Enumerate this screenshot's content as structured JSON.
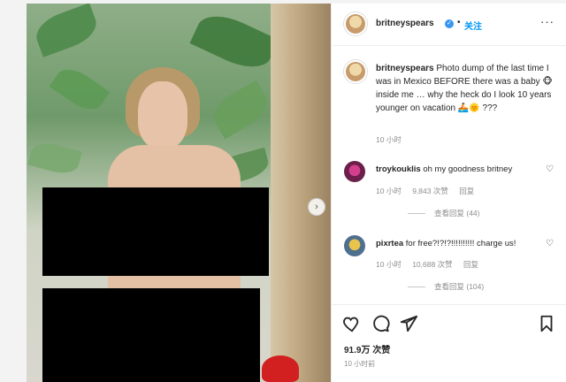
{
  "post": {
    "username": "britneyspears",
    "follow_label": "关注",
    "caption_username": "britneyspears",
    "caption_text": "Photo dump of the last time I was in Mexico BEFORE there was a baby 🐵 inside me … why the heck do I look 10 years younger on vacation 🚣🌞 ???",
    "caption_time": "10 小时",
    "likes": "91.9万 次赞",
    "time_ago": "10 小时前"
  },
  "comments": [
    {
      "username": "troykouklis",
      "text": "oh my goodness britney",
      "time": "10 小时",
      "likes": "9,843 次赞",
      "reply_label": "回复",
      "view_replies": "查看回复 (44)"
    },
    {
      "username": "pixrtea",
      "text": "for free?!?!?!!!!!!!!!! charge us!",
      "time": "10 小时",
      "likes": "10,688 次赞",
      "reply_label": "回复",
      "view_replies": "查看回复 (104)"
    }
  ],
  "icons": {
    "verified": "verified-badge-icon",
    "more": "more-options-icon",
    "next": "chevron-right-icon",
    "like": "heart-icon",
    "comment": "comment-bubble-icon",
    "share": "paper-plane-icon",
    "save": "bookmark-icon"
  },
  "colors": {
    "follow": "#0095f6",
    "verified": "#3897f0",
    "censor": "#000000"
  }
}
